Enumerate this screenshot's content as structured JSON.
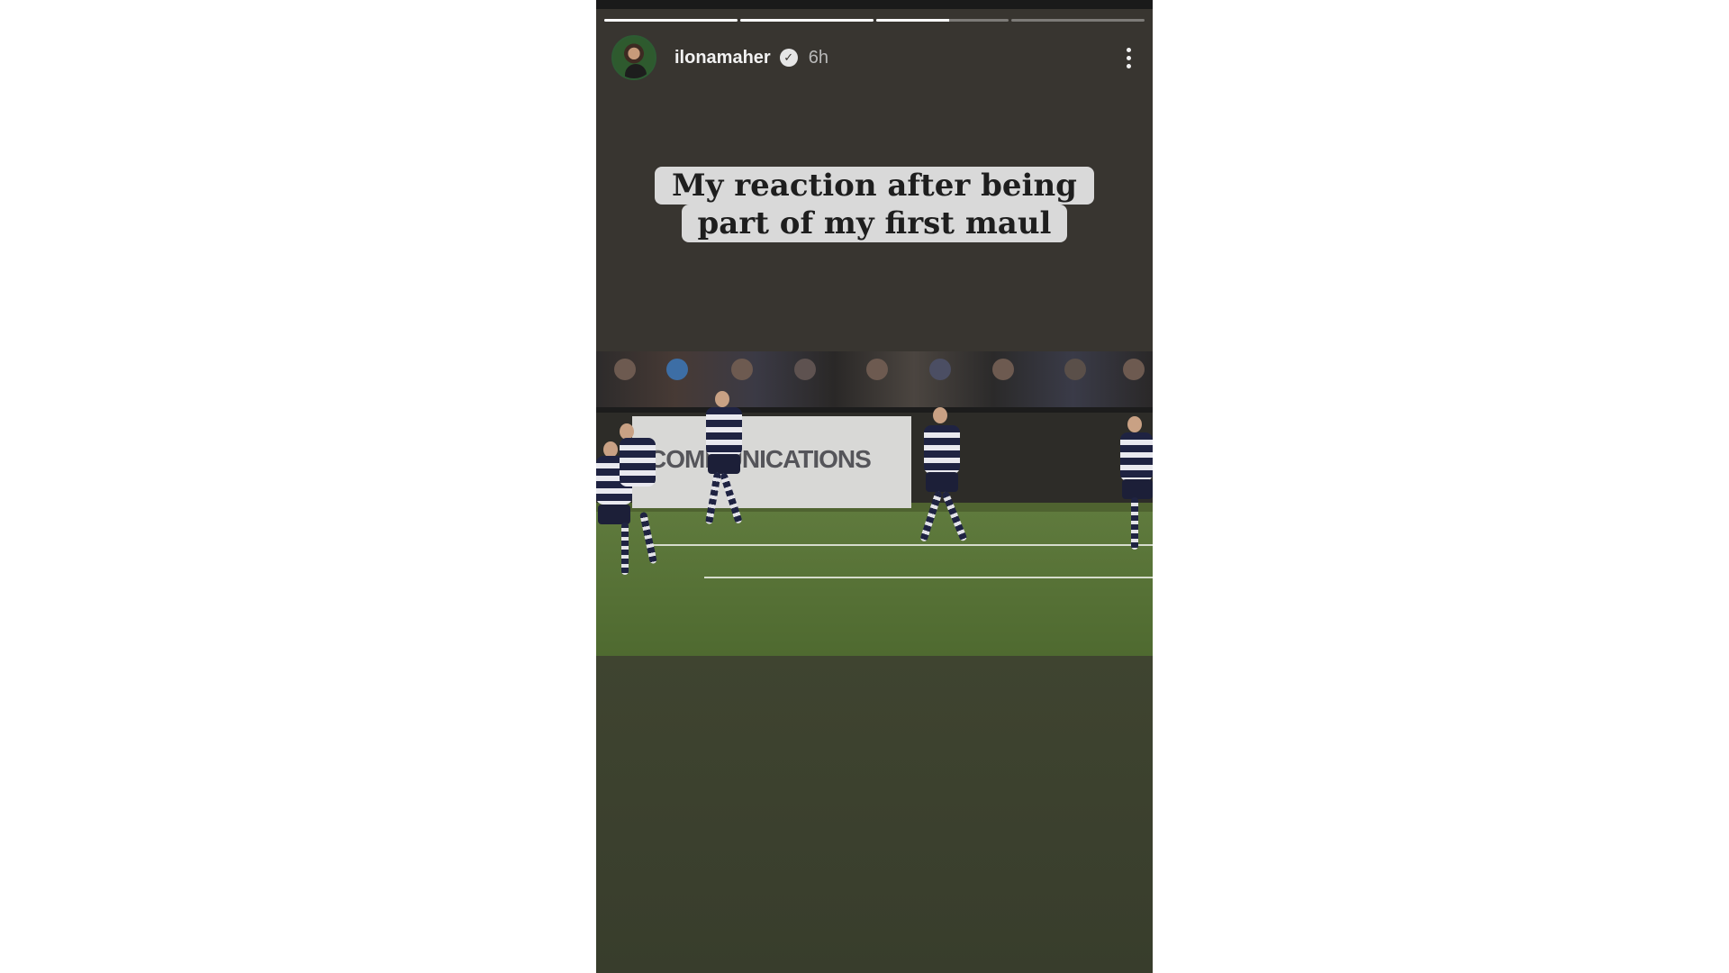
{
  "story": {
    "username": "ilonamaher",
    "time_ago": "6h",
    "progress": [
      1,
      1,
      0.55,
      0
    ],
    "caption_lines": [
      "My reaction after being",
      "part of my first maul"
    ],
    "video": {
      "hoarding_text": "COMMUNICATIONS"
    },
    "icons": {
      "verified": "verified-badge-icon",
      "more": "more-options-icon"
    }
  }
}
